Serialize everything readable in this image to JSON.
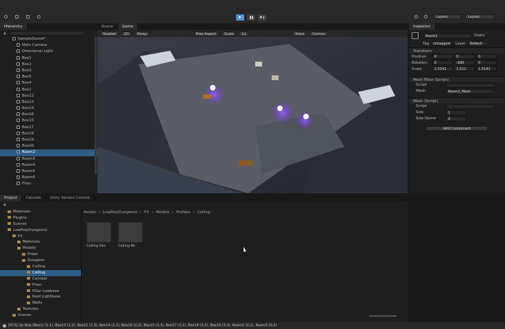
{
  "toolbar": {
    "account_label": "Layers",
    "layout_label": "Layout",
    "play_icon": "play-icon",
    "pause_icon": "pause-icon",
    "step_icon": "step-icon"
  },
  "hierarchy": {
    "tab_label": "Hierarchy",
    "search_placeholder": "",
    "scene_name": "SampleScene*",
    "items": [
      {
        "label": "Main Camera",
        "indent": 2
      },
      {
        "label": "Directional Light",
        "indent": 2
      },
      {
        "label": "Box1",
        "indent": 2
      },
      {
        "label": "Box2",
        "indent": 2
      },
      {
        "label": "Box3",
        "indent": 2
      },
      {
        "label": "Box5",
        "indent": 2
      },
      {
        "label": "Box4",
        "indent": 2
      },
      {
        "label": "Box1",
        "indent": 2
      },
      {
        "label": "Box12",
        "indent": 2
      },
      {
        "label": "Box13",
        "indent": 2
      },
      {
        "label": "Box14",
        "indent": 2
      },
      {
        "label": "Box16",
        "indent": 2
      },
      {
        "label": "Box15",
        "indent": 2
      },
      {
        "label": "Box17",
        "indent": 2
      },
      {
        "label": "Box18",
        "indent": 2
      },
      {
        "label": "Box19",
        "indent": 2
      },
      {
        "label": "Box20",
        "indent": 2
      },
      {
        "label": "Room2",
        "indent": 2,
        "selected": true
      },
      {
        "label": "Room3",
        "indent": 2
      },
      {
        "label": "Room4",
        "indent": 2
      },
      {
        "label": "Room5",
        "indent": 2
      },
      {
        "label": "Room6",
        "indent": 2
      },
      {
        "label": "Floor",
        "indent": 2
      }
    ]
  },
  "scene_view": {
    "tabs": [
      "Scene",
      "Game"
    ],
    "toolbar_items": [
      "Shaded",
      "2D",
      "Persp",
      "Free Aspect",
      "Scale",
      "1x",
      "Stats",
      "Gizmos"
    ]
  },
  "inspector": {
    "tab_label": "Inspector",
    "object_name": "Room2",
    "static_label": "Static",
    "tag_label": "Tag",
    "tag_value": "Untagged",
    "layer_label": "Layer",
    "layer_value": "Default",
    "transform": {
      "title": "Transform",
      "position_label": "Position",
      "rotation_label": "Rotation",
      "scale_label": "Scale",
      "position": [
        "0",
        "0",
        "0"
      ],
      "rotation": [
        "0",
        "-180",
        "0"
      ],
      "scale": [
        "1.5141",
        "1.512",
        "1.5141"
      ]
    },
    "component1": {
      "title": "Mesh Filter (Script)",
      "rows": [
        [
          "Script",
          ""
        ],
        [
          "Mesh",
          "Room2_Mesh"
        ]
      ]
    },
    "component2": {
      "title": "Mesh (Script)",
      "rows": [
        [
          "Script",
          ""
        ],
        [
          "Size",
          "1"
        ],
        [
          "Size Name",
          "0"
        ]
      ]
    },
    "add_component_label": "Add Component"
  },
  "project": {
    "tabs": [
      "Project",
      "Console",
      "Unity Version Control"
    ],
    "breadcrumb": [
      "Assets",
      "LowPolyDungeons",
      "FX",
      "Models",
      "Prefabs",
      "Ceiling"
    ],
    "tree": [
      {
        "label": "Materials",
        "indent": 1
      },
      {
        "label": "Plugins",
        "indent": 1
      },
      {
        "label": "Scenes",
        "indent": 1
      },
      {
        "label": "LowPolyDungeons",
        "indent": 1
      },
      {
        "label": "FX",
        "indent": 2
      },
      {
        "label": "Materials",
        "indent": 3
      },
      {
        "label": "Models",
        "indent": 3
      },
      {
        "label": "Props",
        "indent": 4
      },
      {
        "label": "Dungeon",
        "indent": 4
      },
      {
        "label": "Ceiling",
        "indent": 5
      },
      {
        "label": "Ceiling",
        "indent": 5,
        "selected": true
      },
      {
        "label": "Corridor",
        "indent": 5
      },
      {
        "label": "Floor",
        "indent": 5
      },
      {
        "label": "Pillar Lowbase",
        "indent": 5
      },
      {
        "label": "Roof Lightbase",
        "indent": 5
      },
      {
        "label": "Walls",
        "indent": 5
      },
      {
        "label": "Textures",
        "indent": 3
      },
      {
        "label": "Scenes",
        "indent": 2
      }
    ],
    "assets": [
      {
        "label": "Ceiling Dec"
      },
      {
        "label": "Ceiling Bk"
      }
    ]
  },
  "status_bar": {
    "text": "[ECS] Up Nop (Box1) (1,1), Box13 (1,2), Box12 (1,3), Box14 (2,1), Box16 (2,2), Box15 (2,3), Box17 (3,1), Box18 (3,2), Box19 (3,3), Room2 (0,1), Room3 (0,2)"
  },
  "colors": {
    "selection": "#2c5d87",
    "accent": "#4a7fd1",
    "play_active": "#4f8fd8"
  }
}
